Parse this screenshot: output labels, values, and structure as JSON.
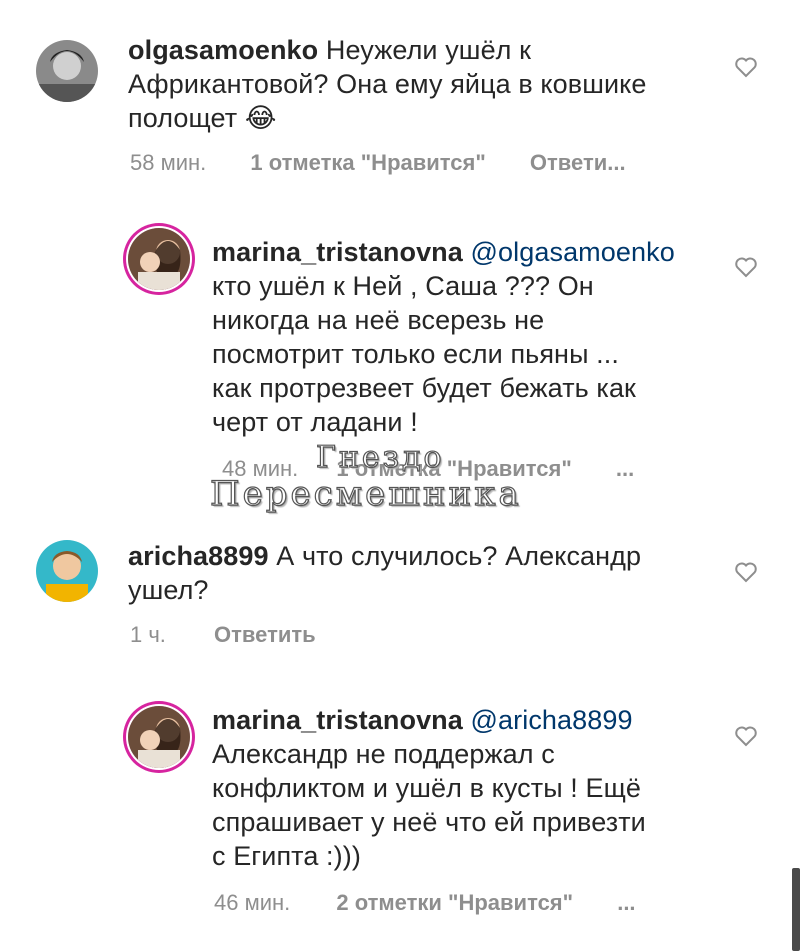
{
  "comments": [
    {
      "username": "olgasamoenko",
      "mention": "",
      "lines": [
        "Неужели ушёл к",
        "Африкантовой? Она ему яйца в ковшике",
        "полощет 😂"
      ],
      "time": "58 мин.",
      "likes": "1 отметка \"Нравится\"",
      "reply": "Ответи...",
      "reply_level": false
    },
    {
      "username": "marina_tristanovna",
      "mention": "@olgasamoenko",
      "lines": [
        "кто ушёл к Ней , Саша ??? Он",
        "никогда на неё всерезь не",
        "посмотрит только если пьяны ...",
        "как протрезвеет будет бежать как",
        "черт от ладани !"
      ],
      "time": "48 мин.",
      "likes": "1 отметка \"Нравится\"",
      "more": "...",
      "reply_level": true
    },
    {
      "username": "aricha8899",
      "mention": "",
      "lines": [
        "А что случилось? Александр",
        "ушел?"
      ],
      "time": "1 ч.",
      "reply": "Ответить",
      "reply_level": false
    },
    {
      "username": "marina_tristanovna",
      "mention": "@aricha8899",
      "lines": [
        "Александр не поддержал с",
        "конфликтом и ушёл  в кусты ! Ещё",
        "спрашивает у неё что ей привезти",
        "с Египта :)))"
      ],
      "time": "46 мин.",
      "likes": "2 отметки \"Нравится\"",
      "more": "...",
      "reply_level": true
    }
  ],
  "watermark": {
    "line1": "Гнездо",
    "line2": "Пересмешника"
  }
}
